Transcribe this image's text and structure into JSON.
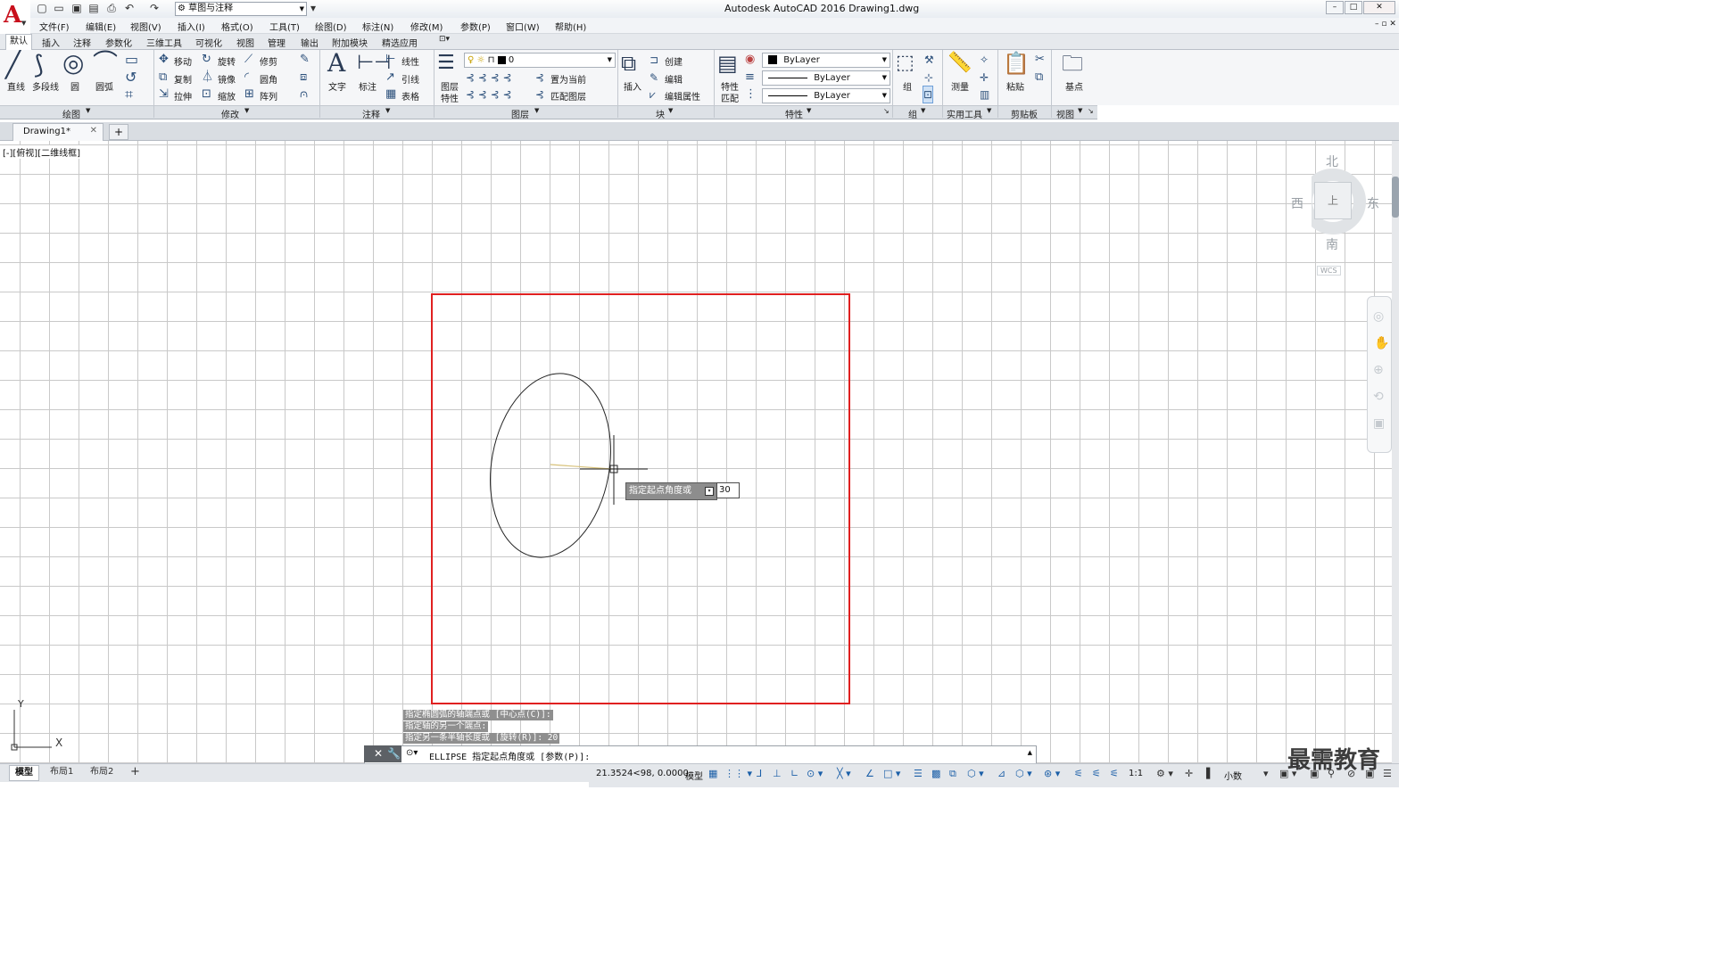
{
  "titlebar": {
    "workspace": "草图与注释",
    "title": "Autodesk AutoCAD 2016    Drawing1.dwg"
  },
  "menubar": [
    "文件(F)",
    "编辑(E)",
    "视图(V)",
    "插入(I)",
    "格式(O)",
    "工具(T)",
    "绘图(D)",
    "标注(N)",
    "修改(M)",
    "参数(P)",
    "窗口(W)",
    "帮助(H)"
  ],
  "ribbon_tabs": [
    "默认",
    "插入",
    "注释",
    "参数化",
    "三维工具",
    "可视化",
    "视图",
    "管理",
    "输出",
    "附加模块",
    "精选应用"
  ],
  "ribbon": {
    "draw": {
      "line": "直线",
      "polyline": "多段线",
      "circle": "圆",
      "arc": "圆弧",
      "title": "绘图"
    },
    "modify": {
      "move": "移动",
      "rotate": "旋转",
      "trim": "修剪",
      "copy": "复制",
      "mirror": "镜像",
      "fillet": "圆角",
      "stretch": "拉伸",
      "scale": "缩放",
      "array": "阵列",
      "title": "修改"
    },
    "annotation": {
      "text": "文字",
      "dimension": "标注",
      "linear": "线性",
      "leader": "引线",
      "table": "表格",
      "title": "注释"
    },
    "layers": {
      "layer_props_1": "图层",
      "layer_props_2": "特性",
      "current_layer": "0",
      "make_current": "置为当前",
      "match_layer": "匹配图层",
      "title": "图层"
    },
    "block": {
      "insert": "插入",
      "create": "创建",
      "edit": "编辑",
      "edit_attr": "编辑属性",
      "title": "块"
    },
    "properties": {
      "match_1": "特性",
      "match_2": "匹配",
      "color": "ByLayer",
      "linetype": "ByLayer",
      "lineweight": "ByLayer",
      "title": "特性"
    },
    "groups": {
      "group": "组",
      "title": "组"
    },
    "utilities": {
      "measure": "测量",
      "title": "实用工具"
    },
    "clipboard": {
      "paste": "粘贴",
      "title": "剪贴板"
    },
    "view": {
      "base": "基点",
      "title": "视图"
    }
  },
  "doc_tab": "Drawing1*",
  "viewport_label": "[-][俯视][二维线框]",
  "viewcube": {
    "north": "北",
    "south": "南",
    "east": "东",
    "west": "西",
    "top": "上",
    "wcs": "WCS"
  },
  "dynamic_input": {
    "prompt": "指定起点角度或",
    "value": "30"
  },
  "command_history": [
    "指定椭圆弧的轴端点或 [中心点(C)]:",
    "指定轴的另一个端点:",
    "指定另一条半轴长度或 [旋转(R)]: 20"
  ],
  "command_line": "ELLIPSE 指定起点角度或 [参数(P)]:",
  "ucs": {
    "x": "X",
    "y": "Y"
  },
  "layout_tabs": [
    "模型",
    "布局1",
    "布局2"
  ],
  "status": {
    "coords": "21.3524<98, 0.0000",
    "model": "模型",
    "scale": "1:1",
    "units": "小数"
  },
  "watermark": "最需教育"
}
